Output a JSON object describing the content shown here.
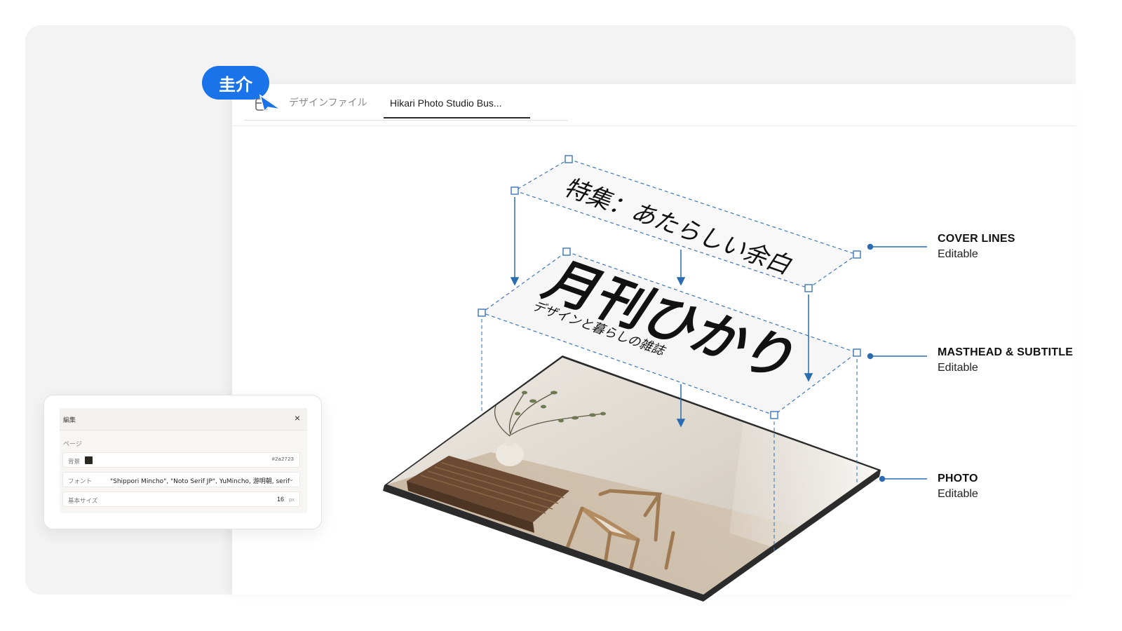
{
  "user": {
    "name": "圭介"
  },
  "tabs": {
    "file_icon": "file-icon",
    "design_files": "デザインファイル",
    "active_file": "Hikari Photo Studio Bus..."
  },
  "cover": {
    "cover_lines": "特集：あたらしい余白",
    "masthead": "月刊ひかり",
    "subtitle": "デザインと暮らしの雑誌"
  },
  "layers": [
    {
      "name": "COVER LINES",
      "state": "Editable"
    },
    {
      "name": "MASTHEAD & SUBTITLE",
      "state": "Editable"
    },
    {
      "name": "PHOTO",
      "state": "Editable"
    }
  ],
  "edit_panel": {
    "title": "編集",
    "close": "×",
    "section": "ページ",
    "background": {
      "label": "背景",
      "color": "#2a2723",
      "hex": "#2a2723"
    },
    "font": {
      "label": "フォント",
      "value": "\"Shippori Mincho\", \"Noto Serif JP\", YuMincho, 游明朝, serif"
    },
    "base_size": {
      "label": "基本サイズ",
      "value": "16",
      "unit": "px"
    }
  },
  "colors": {
    "accent": "#1a73e8",
    "guide": "#2b6cb0"
  }
}
